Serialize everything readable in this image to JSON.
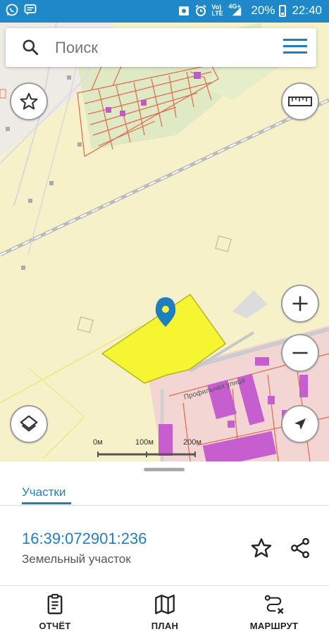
{
  "status_bar": {
    "network_top": "Vo)",
    "network_bottom": "LTE",
    "signal_type": "4G+",
    "battery_percent": "20%",
    "time": "22:40",
    "icons": [
      "whatsapp-icon",
      "message-icon",
      "screenshot-icon",
      "alarm-icon",
      "signal-icon",
      "battery-icon"
    ]
  },
  "search": {
    "placeholder": "Поиск"
  },
  "map": {
    "street_label": "Профильная улица",
    "selected_parcel_fill": "#f5f531",
    "marker_color": "#1e7fc0",
    "scale_labels": [
      "0м",
      "100м",
      "200м"
    ],
    "buttons": [
      "favorite-star-icon",
      "ruler-icon",
      "zoom-in-icon",
      "zoom-out-icon",
      "layers-icon",
      "compass-icon"
    ]
  },
  "sheet": {
    "tab_label": "Участки",
    "parcel_number": "16:39:072901:236",
    "parcel_type": "Земельный участок"
  },
  "bottom_nav": {
    "items": [
      {
        "label": "ОТЧЁТ",
        "icon": "report-icon"
      },
      {
        "label": "ПЛАН",
        "icon": "map-plan-icon"
      },
      {
        "label": "МАРШРУТ",
        "icon": "route-icon"
      }
    ]
  },
  "colors": {
    "accent": "#1e7fc0",
    "status_bar": "#1e88c9"
  }
}
